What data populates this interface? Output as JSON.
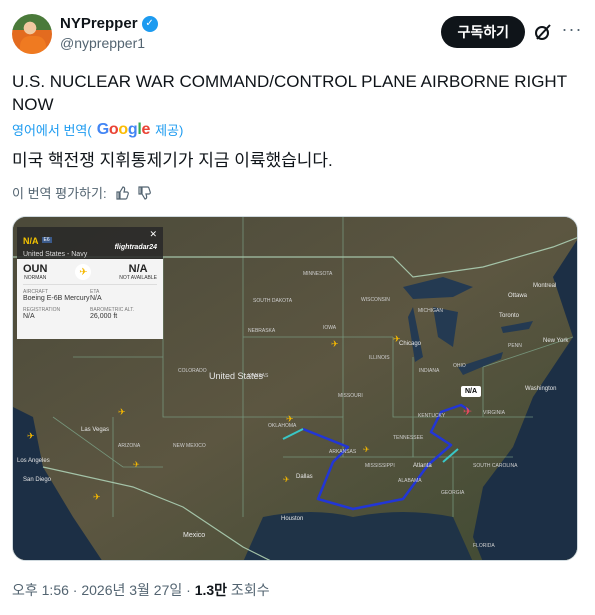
{
  "author": {
    "display_name": "NYPrepper",
    "handle": "@nyprepper1",
    "verified_icon": "verified-badge-icon"
  },
  "actions": {
    "subscribe_label": "구독하기"
  },
  "tweet": {
    "text": "U.S. NUCLEAR WAR COMMAND/CONTROL PLANE AIRBORNE RIGHT NOW",
    "translate_prefix": "영어에서 번역(",
    "translate_brand": "Google",
    "translate_suffix": "제공)",
    "translated_text": "미국 핵전쟁 지휘통제기가 지금 이륙했습니다.",
    "rate_label": "이 번역 평가하기:"
  },
  "map": {
    "info": {
      "callsign": "N/A",
      "badge": "E6",
      "owner": "United States - Navy",
      "brand": "flightradar24",
      "origin_code": "OUN",
      "origin_name": "NORMAN",
      "dest_code": "N/A",
      "dest_name": "NOT AVAILABLE",
      "aircraft_label": "AIRCRAFT",
      "aircraft_value": "Boeing E-6B Mercury",
      "eta_label": "ETA",
      "eta_value": "N/A",
      "registration_label": "REGISTRATION",
      "registration_value": "N/A",
      "altitude_label": "BAROMETRIC ALT.",
      "altitude_value": "26,000 ft"
    },
    "aircraft_tag": "N/A",
    "labels": {
      "minnesota": "MINNESOTA",
      "wisconsin": "WISCONSIN",
      "michigan": "MICHIGAN",
      "montreal": "Montreal",
      "ottawa": "Ottawa",
      "toronto": "Toronto",
      "chicago": "Chicago",
      "illinois": "ILLINOIS",
      "ohio": "OHIO",
      "indiana": "INDIANA",
      "pennsylvania": "PENN",
      "new_york": "New York",
      "washington": "Washington",
      "virginia": "VIRGINIA",
      "kentucky": "KENTUCKY",
      "tennessee": "TENNESSEE",
      "atlanta": "Atlanta",
      "south_carolina": "SOUTH CAROLINA",
      "georgia": "GEORGIA",
      "alabama": "ALABAMA",
      "mississippi": "MISSISSIPPI",
      "arkansas": "ARKANSAS",
      "dallas": "Dallas",
      "houston": "Houston",
      "united_states": "United States",
      "las_vegas": "Las Vegas",
      "los_angeles": "Los Angeles",
      "san_diego": "San Diego",
      "florida": "FLORIDA",
      "kansas": "KANSAS",
      "nebraska": "NEBRASKA",
      "dakota": "SOUTH DAKOTA",
      "new_mexico": "NEW MEXICO",
      "arizona": "ARIZONA",
      "oklahoma": "OKLAHOMA",
      "missouri": "MISSOURI",
      "iowa": "IOWA",
      "colorado": "COLORADO",
      "mexico": "Mexico"
    }
  },
  "footer": {
    "time": "오후 1:56 · 2026년 3월 27일 · ",
    "views_count": "1.3만",
    "views_label": " 조회수"
  }
}
